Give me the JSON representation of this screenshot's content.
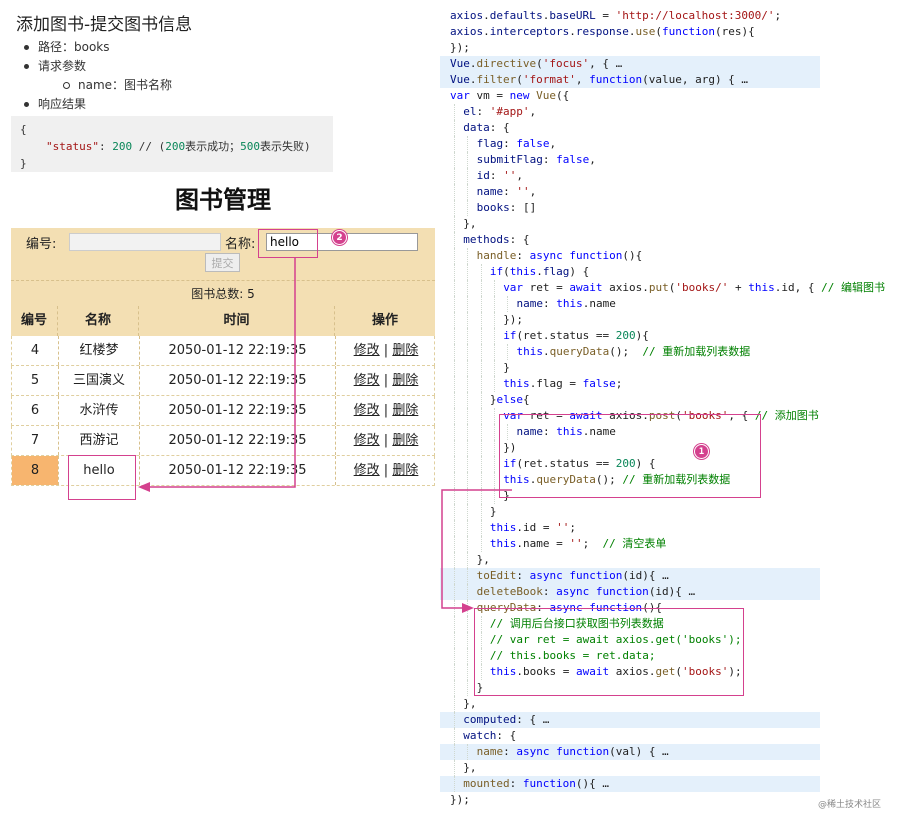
{
  "doc": {
    "title": "添加图书-提交图书信息",
    "items": [
      {
        "label": "路径：books",
        "level": 0
      },
      {
        "label": "请求参数",
        "level": 0
      },
      {
        "label": "name：图书名称",
        "level": 1
      },
      {
        "label": "响应结果",
        "level": 0
      }
    ],
    "response": {
      "open": "{",
      "key": "\"status\"",
      "value": "200",
      "comment_pre": "// (",
      "success_code": "200",
      "success_text": "表示成功；",
      "fail_code": "500",
      "fail_text": "表示失败)",
      "close": "}"
    }
  },
  "app": {
    "title": "图书管理",
    "form": {
      "id_label": "编号:",
      "id_value": "",
      "name_label": "名称:",
      "name_value": "hello",
      "submit_label": "提交"
    },
    "total_label": "图书总数:",
    "total_value": "5",
    "columns": [
      "编号",
      "名称",
      "时间",
      "操作"
    ],
    "rows": [
      {
        "id": "4",
        "name": "红楼梦",
        "date": "2050-01-12 22:19:35",
        "edit": "修改",
        "sep": "|",
        "del": "删除"
      },
      {
        "id": "5",
        "name": "三国演义",
        "date": "2050-01-12 22:19:35",
        "edit": "修改",
        "sep": "|",
        "del": "删除"
      },
      {
        "id": "6",
        "name": "水浒传",
        "date": "2050-01-12 22:19:35",
        "edit": "修改",
        "sep": "|",
        "del": "删除"
      },
      {
        "id": "7",
        "name": "西游记",
        "date": "2050-01-12 22:19:35",
        "edit": "修改",
        "sep": "|",
        "del": "删除"
      },
      {
        "id": "8",
        "name": "hello",
        "date": "2050-01-12 22:19:35",
        "edit": "修改",
        "sep": "|",
        "del": "删除"
      }
    ]
  },
  "annotations": {
    "badge_1": "1",
    "badge_2": "2",
    "accent": "#d4418e"
  },
  "editor": {
    "lines": [
      {
        "indent": 0,
        "fold": false,
        "tokens": [
          [
            "v",
            "axios"
          ],
          [
            "p",
            "."
          ],
          [
            "v",
            "defaults"
          ],
          [
            "p",
            "."
          ],
          [
            "v",
            "baseURL"
          ],
          [
            "p",
            " = "
          ],
          [
            "s",
            "'http://localhost:3000/'"
          ],
          [
            "p",
            ";"
          ]
        ]
      },
      {
        "indent": 0,
        "fold": false,
        "tokens": [
          [
            "v",
            "axios"
          ],
          [
            "p",
            "."
          ],
          [
            "v",
            "interceptors"
          ],
          [
            "p",
            "."
          ],
          [
            "v",
            "response"
          ],
          [
            "p",
            "."
          ],
          [
            "f",
            "use"
          ],
          [
            "p",
            "("
          ],
          [
            "k",
            "function"
          ],
          [
            "p",
            "(res){"
          ]
        ]
      },
      {
        "indent": 0,
        "fold": false,
        "tokens": [
          [
            "p",
            "});"
          ]
        ]
      },
      {
        "indent": 0,
        "fold": true,
        "tokens": [
          [
            "v",
            "Vue"
          ],
          [
            "p",
            "."
          ],
          [
            "f",
            "directive"
          ],
          [
            "p",
            "("
          ],
          [
            "s",
            "'focus'"
          ],
          [
            "p",
            ", {"
          ],
          [
            "p",
            " …"
          ]
        ]
      },
      {
        "indent": 0,
        "fold": true,
        "tokens": [
          [
            "v",
            "Vue"
          ],
          [
            "p",
            "."
          ],
          [
            "f",
            "filter"
          ],
          [
            "p",
            "("
          ],
          [
            "s",
            "'format'"
          ],
          [
            "p",
            ", "
          ],
          [
            "k",
            "function"
          ],
          [
            "p",
            "(value, arg) {"
          ],
          [
            "p",
            " …"
          ]
        ]
      },
      {
        "indent": 0,
        "fold": false,
        "tokens": [
          [
            "k",
            "var"
          ],
          [
            "p",
            " vm = "
          ],
          [
            "k",
            "new"
          ],
          [
            "p",
            " "
          ],
          [
            "f",
            "Vue"
          ],
          [
            "p",
            "({"
          ]
        ]
      },
      {
        "indent": 1,
        "fold": false,
        "tokens": [
          [
            "v",
            "el"
          ],
          [
            "p",
            ": "
          ],
          [
            "s",
            "'#app'"
          ],
          [
            "p",
            ","
          ]
        ]
      },
      {
        "indent": 1,
        "fold": false,
        "tokens": [
          [
            "v",
            "data"
          ],
          [
            "p",
            ": {"
          ]
        ]
      },
      {
        "indent": 2,
        "fold": false,
        "tokens": [
          [
            "v",
            "flag"
          ],
          [
            "p",
            ": "
          ],
          [
            "k",
            "false"
          ],
          [
            "p",
            ","
          ]
        ]
      },
      {
        "indent": 2,
        "fold": false,
        "tokens": [
          [
            "v",
            "submitFlag"
          ],
          [
            "p",
            ": "
          ],
          [
            "k",
            "false"
          ],
          [
            "p",
            ","
          ]
        ]
      },
      {
        "indent": 2,
        "fold": false,
        "tokens": [
          [
            "v",
            "id"
          ],
          [
            "p",
            ": "
          ],
          [
            "s",
            "''"
          ],
          [
            "p",
            ","
          ]
        ]
      },
      {
        "indent": 2,
        "fold": false,
        "tokens": [
          [
            "v",
            "name"
          ],
          [
            "p",
            ": "
          ],
          [
            "s",
            "''"
          ],
          [
            "p",
            ","
          ]
        ]
      },
      {
        "indent": 2,
        "fold": false,
        "tokens": [
          [
            "v",
            "books"
          ],
          [
            "p",
            ": []"
          ]
        ]
      },
      {
        "indent": 1,
        "fold": false,
        "tokens": [
          [
            "p",
            "},"
          ]
        ]
      },
      {
        "indent": 1,
        "fold": false,
        "tokens": [
          [
            "v",
            "methods"
          ],
          [
            "p",
            ": {"
          ]
        ]
      },
      {
        "indent": 2,
        "fold": false,
        "tokens": [
          [
            "f",
            "handle"
          ],
          [
            "p",
            ": "
          ],
          [
            "k",
            "async"
          ],
          [
            "p",
            " "
          ],
          [
            "k",
            "function"
          ],
          [
            "p",
            "(){"
          ]
        ]
      },
      {
        "indent": 3,
        "fold": false,
        "tokens": [
          [
            "k",
            "if"
          ],
          [
            "p",
            "("
          ],
          [
            "k",
            "this"
          ],
          [
            "p",
            "."
          ],
          [
            "v",
            "flag"
          ],
          [
            "p",
            ") {"
          ]
        ]
      },
      {
        "indent": 4,
        "fold": false,
        "tokens": [
          [
            "k",
            "var"
          ],
          [
            "p",
            " ret = "
          ],
          [
            "k",
            "await"
          ],
          [
            "p",
            " axios."
          ],
          [
            "f",
            "put"
          ],
          [
            "p",
            "("
          ],
          [
            "s",
            "'books/'"
          ],
          [
            "p",
            " + "
          ],
          [
            "k",
            "this"
          ],
          [
            "p",
            ".id, { "
          ],
          [
            "c",
            "// 编辑图书"
          ]
        ]
      },
      {
        "indent": 5,
        "fold": false,
        "tokens": [
          [
            "v",
            "name"
          ],
          [
            "p",
            ": "
          ],
          [
            "k",
            "this"
          ],
          [
            "p",
            ".name"
          ]
        ]
      },
      {
        "indent": 4,
        "fold": false,
        "tokens": [
          [
            "p",
            "});"
          ]
        ]
      },
      {
        "indent": 4,
        "fold": false,
        "tokens": [
          [
            "k",
            "if"
          ],
          [
            "p",
            "(ret.status == "
          ],
          [
            "n",
            "200"
          ],
          [
            "p",
            "){"
          ]
        ]
      },
      {
        "indent": 5,
        "fold": false,
        "tokens": [
          [
            "k",
            "this"
          ],
          [
            "p",
            "."
          ],
          [
            "f",
            "queryData"
          ],
          [
            "p",
            "();  "
          ],
          [
            "c",
            "// 重新加载列表数据"
          ]
        ]
      },
      {
        "indent": 4,
        "fold": false,
        "tokens": [
          [
            "p",
            "}"
          ]
        ]
      },
      {
        "indent": 4,
        "fold": false,
        "tokens": [
          [
            "k",
            "this"
          ],
          [
            "p",
            ".flag = "
          ],
          [
            "k",
            "false"
          ],
          [
            "p",
            ";"
          ]
        ]
      },
      {
        "indent": 3,
        "fold": false,
        "tokens": [
          [
            "p",
            "}"
          ],
          [
            "k",
            "else"
          ],
          [
            "p",
            "{"
          ]
        ]
      },
      {
        "indent": 4,
        "fold": false,
        "tokens": [
          [
            "k",
            "var"
          ],
          [
            "p",
            " ret = "
          ],
          [
            "k",
            "await"
          ],
          [
            "p",
            " axios."
          ],
          [
            "f",
            "post"
          ],
          [
            "p",
            "("
          ],
          [
            "s",
            "'books'"
          ],
          [
            "p",
            ", { "
          ],
          [
            "c",
            "// 添加图书"
          ]
        ]
      },
      {
        "indent": 5,
        "fold": false,
        "tokens": [
          [
            "v",
            "name"
          ],
          [
            "p",
            ": "
          ],
          [
            "k",
            "this"
          ],
          [
            "p",
            ".name"
          ]
        ]
      },
      {
        "indent": 4,
        "fold": false,
        "tokens": [
          [
            "p",
            "})"
          ]
        ]
      },
      {
        "indent": 4,
        "fold": false,
        "tokens": [
          [
            "k",
            "if"
          ],
          [
            "p",
            "(ret.status == "
          ],
          [
            "n",
            "200"
          ],
          [
            "p",
            ") {"
          ]
        ]
      },
      {
        "indent": 4,
        "fold": false,
        "tokens": [
          [
            "k",
            "this"
          ],
          [
            "p",
            "."
          ],
          [
            "f",
            "queryData"
          ],
          [
            "p",
            "(); "
          ],
          [
            "c",
            "// 重新加载列表数据"
          ]
        ]
      },
      {
        "indent": 4,
        "fold": false,
        "tokens": [
          [
            "p",
            "}"
          ]
        ]
      },
      {
        "indent": 3,
        "fold": false,
        "tokens": [
          [
            "p",
            "}"
          ]
        ]
      },
      {
        "indent": 3,
        "fold": false,
        "tokens": [
          [
            "k",
            "this"
          ],
          [
            "p",
            ".id = "
          ],
          [
            "s",
            "''"
          ],
          [
            "p",
            ";"
          ]
        ]
      },
      {
        "indent": 3,
        "fold": false,
        "tokens": [
          [
            "k",
            "this"
          ],
          [
            "p",
            ".name = "
          ],
          [
            "s",
            "''"
          ],
          [
            "p",
            ";  "
          ],
          [
            "c",
            "// 清空表单"
          ]
        ]
      },
      {
        "indent": 2,
        "fold": false,
        "tokens": [
          [
            "p",
            "},"
          ]
        ]
      },
      {
        "indent": 2,
        "fold": true,
        "tokens": [
          [
            "f",
            "toEdit"
          ],
          [
            "p",
            ": "
          ],
          [
            "k",
            "async"
          ],
          [
            "p",
            " "
          ],
          [
            "k",
            "function"
          ],
          [
            "p",
            "(id){"
          ],
          [
            "p",
            " …"
          ]
        ]
      },
      {
        "indent": 2,
        "fold": true,
        "tokens": [
          [
            "f",
            "deleteBook"
          ],
          [
            "p",
            ": "
          ],
          [
            "k",
            "async"
          ],
          [
            "p",
            " "
          ],
          [
            "k",
            "function"
          ],
          [
            "p",
            "(id){"
          ],
          [
            "p",
            " …"
          ]
        ]
      },
      {
        "indent": 2,
        "fold": false,
        "tokens": [
          [
            "f",
            "queryData"
          ],
          [
            "p",
            ": "
          ],
          [
            "k",
            "async"
          ],
          [
            "p",
            " "
          ],
          [
            "k",
            "function"
          ],
          [
            "p",
            "(){"
          ]
        ]
      },
      {
        "indent": 3,
        "fold": false,
        "tokens": [
          [
            "c",
            "// 调用后台接口获取图书列表数据"
          ]
        ]
      },
      {
        "indent": 3,
        "fold": false,
        "tokens": [
          [
            "c",
            "// var ret = await axios.get('books');"
          ]
        ]
      },
      {
        "indent": 3,
        "fold": false,
        "tokens": [
          [
            "c",
            "// this.books = ret.data;"
          ]
        ]
      },
      {
        "indent": 3,
        "fold": false,
        "tokens": [
          [
            "k",
            "this"
          ],
          [
            "p",
            ".books = "
          ],
          [
            "k",
            "await"
          ],
          [
            "p",
            " axios."
          ],
          [
            "f",
            "get"
          ],
          [
            "p",
            "("
          ],
          [
            "s",
            "'books'"
          ],
          [
            "p",
            ");"
          ]
        ]
      },
      {
        "indent": 2,
        "fold": false,
        "tokens": [
          [
            "p",
            "}"
          ]
        ]
      },
      {
        "indent": 1,
        "fold": false,
        "tokens": [
          [
            "p",
            "},"
          ]
        ]
      },
      {
        "indent": 1,
        "fold": true,
        "tokens": [
          [
            "v",
            "computed"
          ],
          [
            "p",
            ": {"
          ],
          [
            "p",
            " …"
          ]
        ]
      },
      {
        "indent": 1,
        "fold": false,
        "tokens": [
          [
            "v",
            "watch"
          ],
          [
            "p",
            ": {"
          ]
        ]
      },
      {
        "indent": 2,
        "fold": true,
        "tokens": [
          [
            "f",
            "name"
          ],
          [
            "p",
            ": "
          ],
          [
            "k",
            "async"
          ],
          [
            "p",
            " "
          ],
          [
            "k",
            "function"
          ],
          [
            "p",
            "(val) {"
          ],
          [
            "p",
            " …"
          ]
        ]
      },
      {
        "indent": 1,
        "fold": false,
        "tokens": [
          [
            "p",
            "},"
          ]
        ]
      },
      {
        "indent": 1,
        "fold": true,
        "tokens": [
          [
            "f",
            "mounted"
          ],
          [
            "p",
            ": "
          ],
          [
            "k",
            "function"
          ],
          [
            "p",
            "(){"
          ],
          [
            "p",
            " …"
          ]
        ]
      },
      {
        "indent": 0,
        "fold": false,
        "tokens": [
          [
            "p",
            "});"
          ]
        ]
      }
    ],
    "watermark": "@稀土技术社区"
  }
}
